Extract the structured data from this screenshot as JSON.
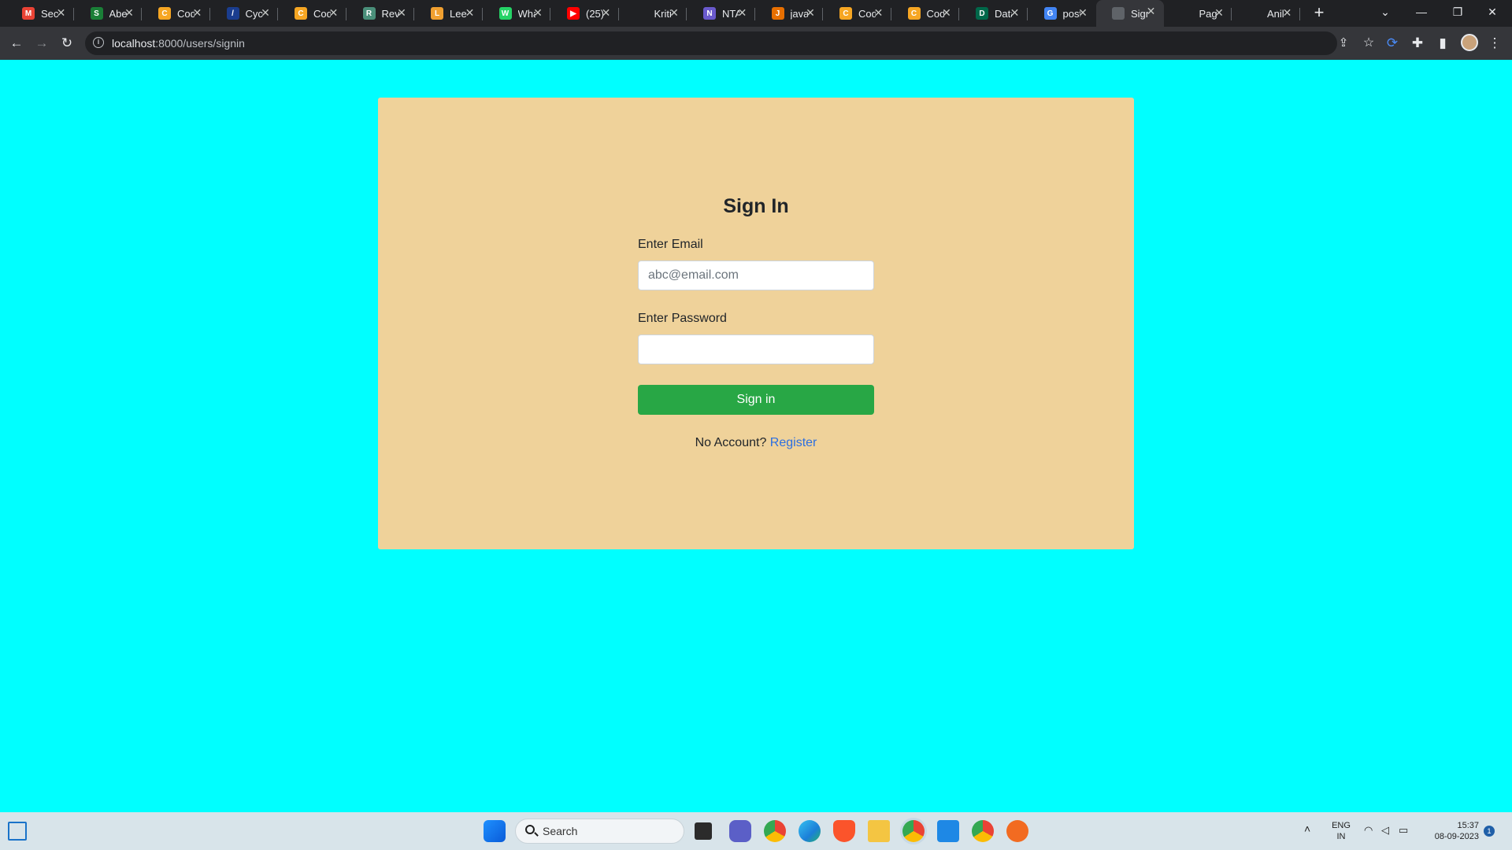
{
  "browser": {
    "tabs": [
      {
        "title": "Secu",
        "favicon_color": "#ea4335",
        "favicon_glyph": "M"
      },
      {
        "title": "Abe",
        "favicon_color": "#1a7f37",
        "favicon_glyph": "S"
      },
      {
        "title": "Cod",
        "favicon_color": "#f6a623",
        "favicon_glyph": "C"
      },
      {
        "title": "Cycl",
        "favicon_color": "#1a3d8f",
        "favicon_glyph": "/"
      },
      {
        "title": "Cod",
        "favicon_color": "#f6a623",
        "favicon_glyph": "C"
      },
      {
        "title": "Revi",
        "favicon_color": "#4a8f7a",
        "favicon_glyph": "R"
      },
      {
        "title": "Leet",
        "favicon_color": "#f0a030",
        "favicon_glyph": "L"
      },
      {
        "title": "Wha",
        "favicon_color": "#25d366",
        "favicon_glyph": "W"
      },
      {
        "title": "(25)",
        "favicon_color": "#ff0000",
        "favicon_glyph": "▶"
      },
      {
        "title": "Kriti",
        "favicon_color": "#202124",
        "favicon_glyph": ""
      },
      {
        "title": "NTA",
        "favicon_color": "#6a5acd",
        "favicon_glyph": "N"
      },
      {
        "title": "java",
        "favicon_color": "#e76f00",
        "favicon_glyph": "J"
      },
      {
        "title": "Cod",
        "favicon_color": "#f6a623",
        "favicon_glyph": "C"
      },
      {
        "title": "Cod",
        "favicon_color": "#f6a623",
        "favicon_glyph": "C"
      },
      {
        "title": "Data",
        "favicon_color": "#00684a",
        "favicon_glyph": "D"
      },
      {
        "title": "post",
        "favicon_color": "#4285f4",
        "favicon_glyph": "G"
      },
      {
        "title": "Sign",
        "favicon_color": "#5f6368",
        "favicon_glyph": ""
      },
      {
        "title": "Pag",
        "favicon_color": "#202124",
        "favicon_glyph": ""
      },
      {
        "title": "Anil",
        "favicon_color": "#202124",
        "favicon_glyph": ""
      }
    ],
    "active_tab_index": 16,
    "url_host": "localhost",
    "url_rest": ":8000/users/signin"
  },
  "form": {
    "title": "Sign In",
    "email_label": "Enter Email",
    "email_placeholder": "abc@email.com",
    "email_value": "",
    "password_label": "Enter Password",
    "password_value": "",
    "submit_label": "Sign in",
    "no_account_text": "No Account?",
    "register_link": "Register"
  },
  "taskbar": {
    "search_label": "Search",
    "lang_line1": "ENG",
    "lang_line2": "IN",
    "time": "15:37",
    "date": "08-09-2023",
    "notification_count": "1"
  },
  "colors": {
    "page_bg": "#00ffff",
    "card_bg": "#efd29a",
    "button_bg": "#28a745",
    "link": "#2c6fe0"
  }
}
